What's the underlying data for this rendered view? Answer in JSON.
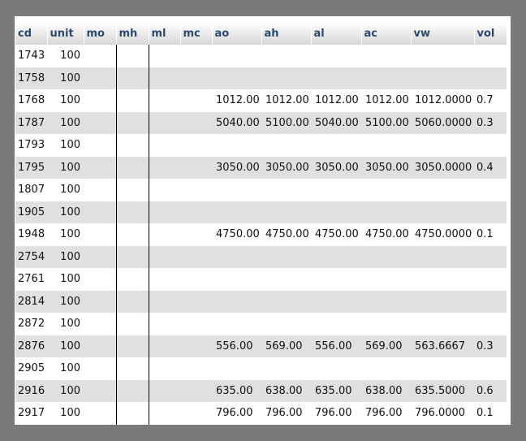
{
  "columns": [
    "cd",
    "unit",
    "mo",
    "mh",
    "ml",
    "mc",
    "ao",
    "ah",
    "al",
    "ac",
    "vw",
    "vol"
  ],
  "rows": [
    [
      "1743",
      "100",
      "",
      "",
      "",
      "",
      "",
      "",
      "",
      "",
      "",
      ""
    ],
    [
      "1758",
      "100",
      "",
      "",
      "",
      "",
      "",
      "",
      "",
      "",
      "",
      ""
    ],
    [
      "1768",
      "100",
      "",
      "",
      "",
      "",
      "1012.00",
      "1012.00",
      "1012.00",
      "1012.00",
      "1012.0000",
      "0.7"
    ],
    [
      "1787",
      "100",
      "",
      "",
      "",
      "",
      "5040.00",
      "5100.00",
      "5040.00",
      "5100.00",
      "5060.0000",
      "0.3"
    ],
    [
      "1793",
      "100",
      "",
      "",
      "",
      "",
      "",
      "",
      "",
      "",
      "",
      ""
    ],
    [
      "1795",
      "100",
      "",
      "",
      "",
      "",
      "3050.00",
      "3050.00",
      "3050.00",
      "3050.00",
      "3050.0000",
      "0.4"
    ],
    [
      "1807",
      "100",
      "",
      "",
      "",
      "",
      "",
      "",
      "",
      "",
      "",
      ""
    ],
    [
      "1905",
      "100",
      "",
      "",
      "",
      "",
      "",
      "",
      "",
      "",
      "",
      ""
    ],
    [
      "1948",
      "100",
      "",
      "",
      "",
      "",
      "4750.00",
      "4750.00",
      "4750.00",
      "4750.00",
      "4750.0000",
      "0.1"
    ],
    [
      "2754",
      "100",
      "",
      "",
      "",
      "",
      "",
      "",
      "",
      "",
      "",
      ""
    ],
    [
      "2761",
      "100",
      "",
      "",
      "",
      "",
      "",
      "",
      "",
      "",
      "",
      ""
    ],
    [
      "2814",
      "100",
      "",
      "",
      "",
      "",
      "",
      "",
      "",
      "",
      "",
      ""
    ],
    [
      "2872",
      "100",
      "",
      "",
      "",
      "",
      "",
      "",
      "",
      "",
      "",
      ""
    ],
    [
      "2876",
      "100",
      "",
      "",
      "",
      "",
      "556.00",
      "569.00",
      "556.00",
      "569.00",
      "563.6667",
      "0.3"
    ],
    [
      "2905",
      "100",
      "",
      "",
      "",
      "",
      "",
      "",
      "",
      "",
      "",
      ""
    ],
    [
      "2916",
      "100",
      "",
      "",
      "",
      "",
      "635.00",
      "638.00",
      "635.00",
      "638.00",
      "635.5000",
      "0.6"
    ],
    [
      "2917",
      "100",
      "",
      "",
      "",
      "",
      "796.00",
      "796.00",
      "796.00",
      "796.00",
      "796.0000",
      "0.1"
    ]
  ]
}
